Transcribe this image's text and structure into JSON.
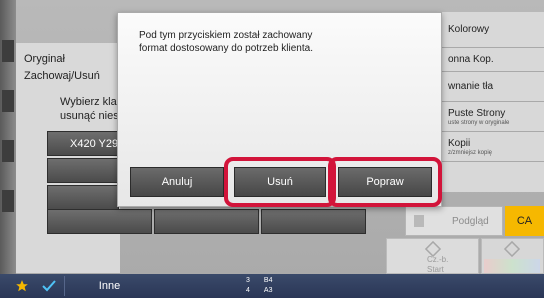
{
  "background": {
    "panel_title": "Oryginał",
    "panel_subtitle": "Zachowaj/Usuń",
    "instruction_line1": "Wybierz kla",
    "instruction_line2": "usunąć nies",
    "list_item_label": "X420 Y29"
  },
  "right_column": {
    "color_mode": "Kolorowy",
    "copy_mode": "onna Kop.",
    "bg_adjust": "wnanie tła",
    "skip_blank_title": "Puste Strony",
    "skip_blank_sub": "uste strony w oryginale",
    "copies_title": "Kopii",
    "copies_sub": "z/zmniejsz kopię",
    "preview_label": "Podgląd",
    "ca_label": "CA",
    "start_bw_line1": "Cz.-b.",
    "start_bw_line2": "Start"
  },
  "bottom_bar": {
    "other_label": "Inne",
    "tray_a_number": "3",
    "tray_a_size": "B4",
    "tray_b_number": "4",
    "tray_b_size": "A3"
  },
  "dialog": {
    "message_line1": "Pod tym przyciskiem został zachowany",
    "message_line2": "format dostosowany do potrzeb klienta.",
    "cancel_label": "Anuluj",
    "delete_label": "Usuń",
    "edit_label": "Popraw"
  },
  "colors": {
    "highlight": "#d2143a",
    "ca_button": "#f6b800",
    "bottom_bar": "#2a3656"
  }
}
